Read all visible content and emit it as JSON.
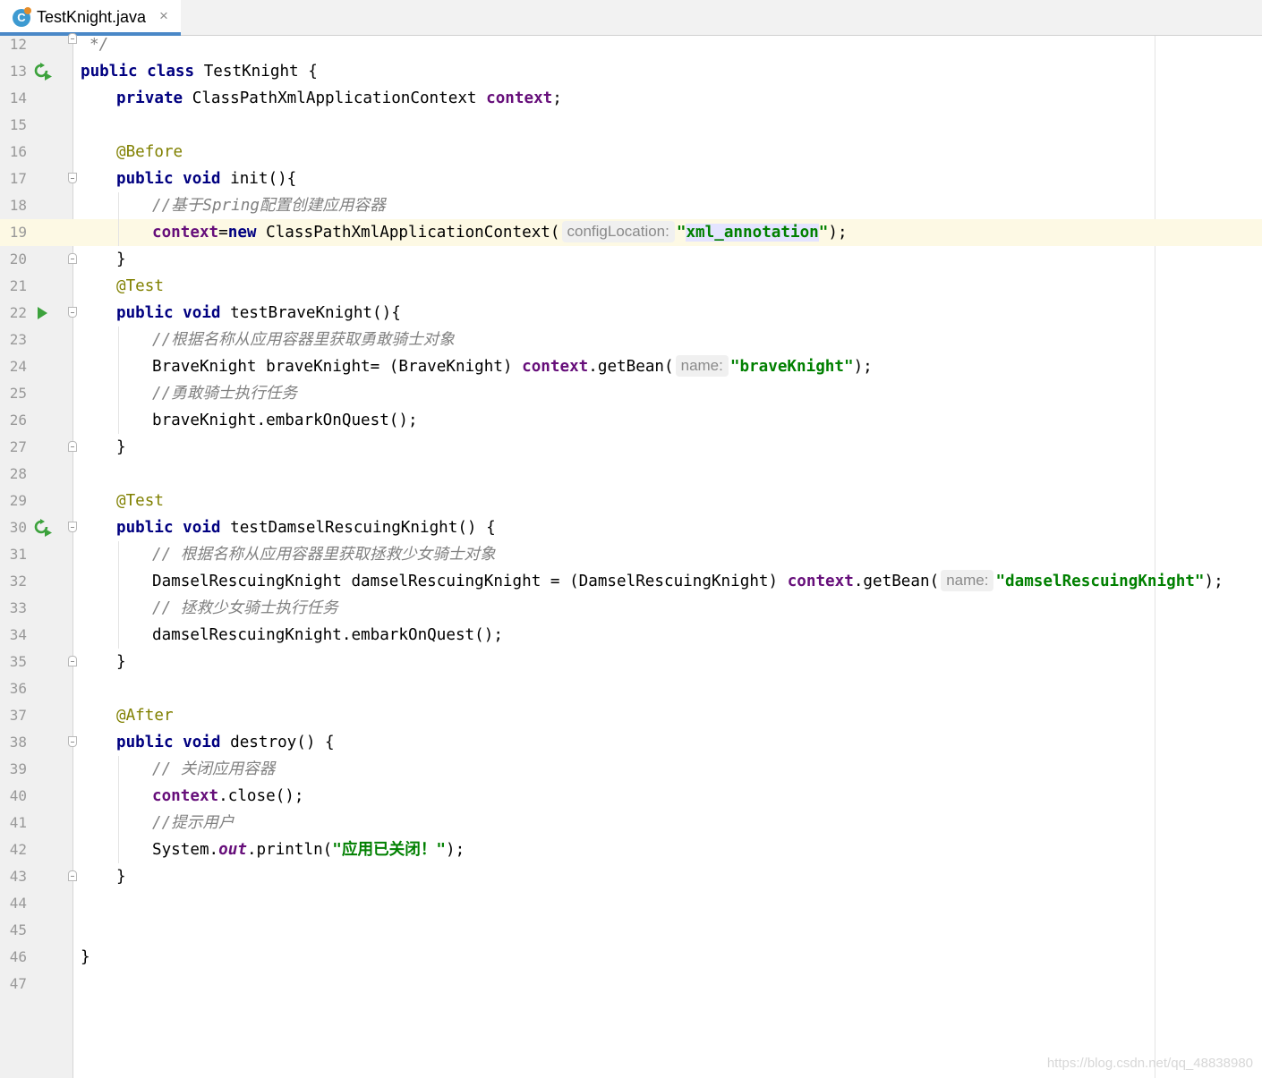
{
  "tab": {
    "icon_letter": "C",
    "title": "TestKnight.java",
    "close_glyph": "×"
  },
  "lines": [
    {
      "n": "12",
      "parts": [
        [
          "cmt",
          "*/"
        ]
      ],
      "indent": 1,
      "gutter": "fold-close-top"
    },
    {
      "n": "13",
      "parts": [
        [
          "kw",
          "public class"
        ],
        [
          "",
          " TestKnight {"
        ]
      ],
      "indent": 0,
      "gutter": "run-class"
    },
    {
      "n": "14",
      "parts": [
        [
          "kw",
          "private"
        ],
        [
          "",
          " ClassPathXmlApplicationContext "
        ],
        [
          "fld",
          "context"
        ],
        [
          "",
          ";"
        ]
      ],
      "indent": 4
    },
    {
      "n": "15",
      "parts": [],
      "indent": 0
    },
    {
      "n": "16",
      "parts": [
        [
          "ann",
          "@Before"
        ]
      ],
      "indent": 4
    },
    {
      "n": "17",
      "parts": [
        [
          "kw",
          "public void"
        ],
        [
          "",
          " init(){"
        ]
      ],
      "indent": 4,
      "gutter": "fold-open"
    },
    {
      "n": "18",
      "parts": [
        [
          "cmt",
          "//基于Spring配置创建应用容器"
        ]
      ],
      "indent": 8
    },
    {
      "n": "19",
      "parts": [
        [
          "fld",
          "context"
        ],
        [
          "",
          "="
        ],
        [
          "kw",
          "new"
        ],
        [
          "",
          " ClassPathXmlApplicationContext("
        ],
        [
          "hint",
          "configLocation:"
        ],
        [
          "str",
          "\""
        ],
        [
          "str sel",
          "xml_annotation"
        ],
        [
          "str",
          "\""
        ],
        [
          "",
          ");"
        ]
      ],
      "indent": 8,
      "caret": true
    },
    {
      "n": "20",
      "parts": [
        [
          "",
          "}"
        ]
      ],
      "indent": 4,
      "gutter": "fold-close"
    },
    {
      "n": "21",
      "parts": [
        [
          "ann",
          "@Test"
        ]
      ],
      "indent": 4
    },
    {
      "n": "22",
      "parts": [
        [
          "kw",
          "public void"
        ],
        [
          "",
          " testBraveKnight(){"
        ]
      ],
      "indent": 4,
      "gutter": "run-fold"
    },
    {
      "n": "23",
      "parts": [
        [
          "cmt",
          "//根据名称从应用容器里获取勇敢骑士对象"
        ]
      ],
      "indent": 8
    },
    {
      "n": "24",
      "parts": [
        [
          "",
          "BraveKnight braveKnight= (BraveKnight) "
        ],
        [
          "fld",
          "context"
        ],
        [
          "",
          ".getBean("
        ],
        [
          "hint",
          "name:"
        ],
        [
          "str",
          "\"braveKnight\""
        ],
        [
          "",
          ");"
        ]
      ],
      "indent": 8
    },
    {
      "n": "25",
      "parts": [
        [
          "cmt",
          "//勇敢骑士执行任务"
        ]
      ],
      "indent": 8
    },
    {
      "n": "26",
      "parts": [
        [
          "",
          "braveKnight.embarkOnQuest();"
        ]
      ],
      "indent": 8
    },
    {
      "n": "27",
      "parts": [
        [
          "",
          "}"
        ]
      ],
      "indent": 4,
      "gutter": "fold-close"
    },
    {
      "n": "28",
      "parts": [],
      "indent": 0
    },
    {
      "n": "29",
      "parts": [
        [
          "ann",
          "@Test"
        ]
      ],
      "indent": 4
    },
    {
      "n": "30",
      "parts": [
        [
          "kw",
          "public void"
        ],
        [
          "",
          " testDamselRescuingKnight() {"
        ]
      ],
      "indent": 4,
      "gutter": "refresh-fold"
    },
    {
      "n": "31",
      "parts": [
        [
          "cmt",
          "// 根据名称从应用容器里获取拯救少女骑士对象"
        ]
      ],
      "indent": 8
    },
    {
      "n": "32",
      "parts": [
        [
          "",
          "DamselRescuingKnight damselRescuingKnight = (DamselRescuingKnight) "
        ],
        [
          "fld",
          "context"
        ],
        [
          "",
          ".getBean("
        ],
        [
          "hint",
          "name:"
        ],
        [
          "str",
          "\"damselRescuingKnight\""
        ],
        [
          "",
          ");"
        ]
      ],
      "indent": 8
    },
    {
      "n": "33",
      "parts": [
        [
          "cmt",
          "// 拯救少女骑士执行任务"
        ]
      ],
      "indent": 8
    },
    {
      "n": "34",
      "parts": [
        [
          "",
          "damselRescuingKnight.embarkOnQuest();"
        ]
      ],
      "indent": 8
    },
    {
      "n": "35",
      "parts": [
        [
          "",
          "}"
        ]
      ],
      "indent": 4,
      "gutter": "fold-close"
    },
    {
      "n": "36",
      "parts": [],
      "indent": 0
    },
    {
      "n": "37",
      "parts": [
        [
          "ann",
          "@After"
        ]
      ],
      "indent": 4
    },
    {
      "n": "38",
      "parts": [
        [
          "kw",
          "public void"
        ],
        [
          "",
          " destroy() {"
        ]
      ],
      "indent": 4,
      "gutter": "fold-open"
    },
    {
      "n": "39",
      "parts": [
        [
          "cmt",
          "// 关闭应用容器"
        ]
      ],
      "indent": 8
    },
    {
      "n": "40",
      "parts": [
        [
          "fld",
          "context"
        ],
        [
          "",
          ".close();"
        ]
      ],
      "indent": 8
    },
    {
      "n": "41",
      "parts": [
        [
          "cmt",
          "//提示用户"
        ]
      ],
      "indent": 8
    },
    {
      "n": "42",
      "parts": [
        [
          "",
          "System."
        ],
        [
          "stat",
          "out"
        ],
        [
          "",
          ".println("
        ],
        [
          "str",
          "\"应用已关闭！\""
        ],
        [
          "",
          ");"
        ]
      ],
      "indent": 8
    },
    {
      "n": "43",
      "parts": [
        [
          "",
          "}"
        ]
      ],
      "indent": 4,
      "gutter": "fold-close"
    },
    {
      "n": "44",
      "parts": [],
      "indent": 0
    },
    {
      "n": "45",
      "parts": [],
      "indent": 0
    },
    {
      "n": "46",
      "parts": [
        [
          "",
          "}"
        ]
      ],
      "indent": 0
    },
    {
      "n": "47",
      "parts": [],
      "indent": 0
    }
  ],
  "watermark": "https://blog.csdn.net/qq_48838980",
  "colors": {
    "keyword": "#000080",
    "field": "#660e7a",
    "annotation": "#808000",
    "comment": "#808080",
    "string": "#008000",
    "caret_row": "#fdf9e4",
    "selection": "#e4e4ff"
  }
}
